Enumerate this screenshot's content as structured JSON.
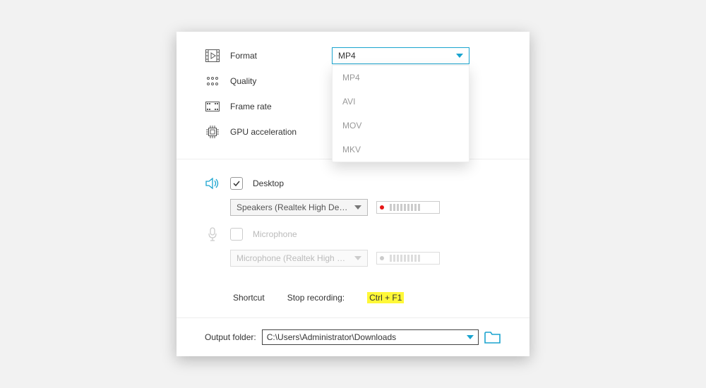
{
  "video": {
    "format": {
      "label": "Format",
      "value": "MP4",
      "options": [
        "MP4",
        "AVI",
        "MOV",
        "MKV"
      ]
    },
    "quality": {
      "label": "Quality"
    },
    "framerate": {
      "label": "Frame rate"
    },
    "gpu": {
      "label": "GPU acceleration"
    }
  },
  "audio": {
    "desktop": {
      "label": "Desktop",
      "checked": true,
      "device": "Speakers (Realtek High De…"
    },
    "microphone": {
      "label": "Microphone",
      "checked": false,
      "device": "Microphone (Realtek High …"
    }
  },
  "shortcut": {
    "label": "Shortcut",
    "action": "Stop recording:",
    "keys": "Ctrl + F1"
  },
  "output": {
    "label": "Output folder:",
    "path": "C:\\Users\\Administrator\\Downloads"
  }
}
